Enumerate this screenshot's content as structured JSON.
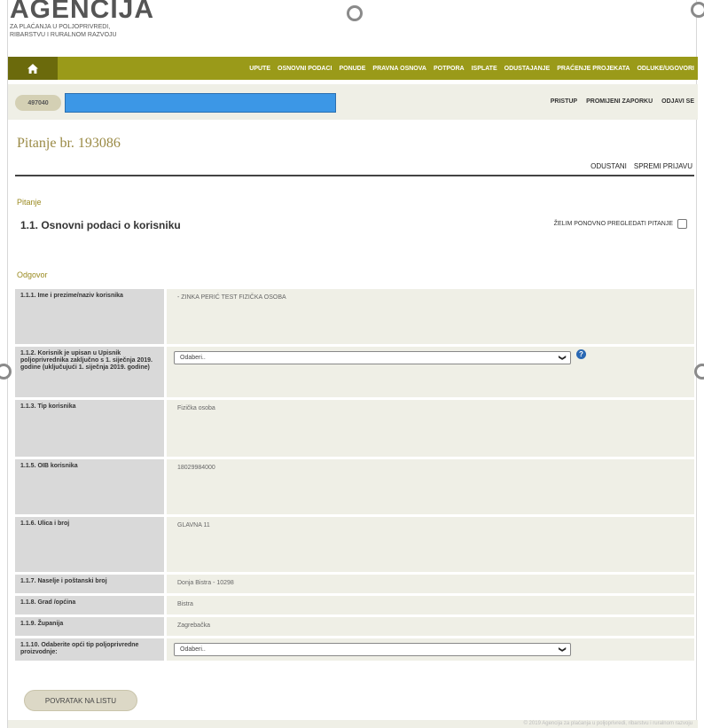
{
  "logo": {
    "title": "AGENCIJA",
    "subtitle_line1": "ZA PLAĆANJA U POLJOPRIVREDI,",
    "subtitle_line2": "RIBARSTVU I RURALNOM RAZVOJU"
  },
  "nav": {
    "home_icon": "home-icon",
    "items": [
      "UPUTE",
      "OSNOVNI PODACI",
      "PONUDE",
      "PRAVNA OSNOVA",
      "POTPORA",
      "ISPLATE",
      "ODUSTAJANJE",
      "PRAĆENJE PROJEKATA",
      "ODLUKE/UGOVORI"
    ]
  },
  "user": {
    "id": "497040",
    "name": "",
    "links": [
      "PRISTUP",
      "PROMIJENI ZAPORKU",
      "ODJAVI SE"
    ]
  },
  "page": {
    "title": "Pitanje br. 193086",
    "actions": [
      "ODUSTANI",
      "SPREMI PRIJAVU"
    ]
  },
  "question": {
    "section_label": "Pitanje",
    "title": "1.1. Osnovni podaci o korisniku",
    "review_label": "ŽELIM PONOVNO PREGLEDATI PITANJE",
    "review_checked": false
  },
  "answer": {
    "section_label": "Odgovor",
    "rows": [
      {
        "label": "1.1.1. Ime i prezime/naziv korisnika",
        "value": "- ZINKA PERIĆ TEST FIZIČKA OSOBA"
      },
      {
        "label": "1.1.2. Korisnik je upisan u Upisnik poljoprivrednika zaključno s 1. siječnja 2019. godine (uključujući 1. siječnja 2019. godine)",
        "select_value": "Odaberi..",
        "has_help": true
      },
      {
        "label": "1.1.3. Tip korisnika",
        "value": "Fizička osoba"
      },
      {
        "label": "1.1.5. OIB korisnika",
        "value": "18029984000"
      },
      {
        "label": "1.1.6. Ulica i broj",
        "value": "GLAVNA 11"
      },
      {
        "label": "1.1.7. Naselje i poštanski broj",
        "value": "Donja Bistra - 10298"
      },
      {
        "label": "1.1.8. Grad /općina",
        "value": "Bistra"
      },
      {
        "label": "1.1.9. Županija",
        "value": "Zagrebačka"
      },
      {
        "label": "1.1.10. Odaberite opći tip poljoprivredne proizvodnje:",
        "select_value": "Odaberi.."
      }
    ]
  },
  "back_button": "POVRATAK NA LISTU",
  "footer": {
    "text": "© 2019 Agencija za plaćanja u poljoprivredi, ribarstvu i ruralnom razvoju"
  },
  "colors": {
    "nav_bg": "#9a9a19",
    "nav_home_bg": "#6b6a0c",
    "user_name_bg": "#3c97e6",
    "accent_text": "#9a8a20"
  }
}
